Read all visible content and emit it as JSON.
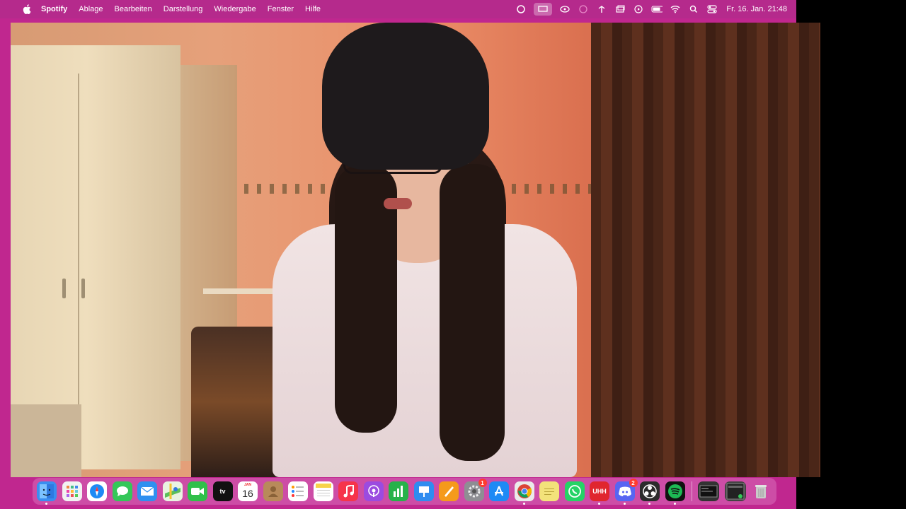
{
  "menubar": {
    "app_name": "Spotify",
    "items": [
      "Ablage",
      "Bearbeiten",
      "Darstellung",
      "Wiedergabe",
      "Fenster",
      "Hilfe"
    ],
    "clock": "Fr. 16. Jan.  21:48",
    "status_icons": [
      "creative-cloud-icon",
      "screen-mirroring-icon",
      "share-icon",
      "record-icon",
      "network-icon",
      "window-icon",
      "play-icon",
      "battery-icon",
      "wifi-icon",
      "search-icon",
      "control-center-icon"
    ]
  },
  "colors": {
    "desktop": "#c0278f",
    "menubar": "#b52a8c"
  },
  "dock": {
    "calendar_month": "JAN",
    "calendar_day": "16",
    "apps": [
      {
        "name": "finder-icon",
        "color": "#3a8ef0"
      },
      {
        "name": "launchpad-icon",
        "color": "#e86a5f"
      },
      {
        "name": "safari-icon",
        "color": "#1e8af5"
      },
      {
        "name": "messages-icon",
        "color": "#34c759"
      },
      {
        "name": "mail-icon",
        "color": "#2f90f0"
      },
      {
        "name": "maps-icon",
        "color": "#5bbf5b"
      },
      {
        "name": "facetime-icon",
        "color": "#30c04a"
      },
      {
        "name": "apple-tv-icon",
        "color": "#111111"
      },
      {
        "name": "calendar-icon",
        "color": "#ffffff"
      },
      {
        "name": "contacts-icon",
        "color": "#b88a5a"
      },
      {
        "name": "reminders-icon",
        "color": "#ffffff"
      },
      {
        "name": "notes-icon",
        "color": "#f7d34a"
      },
      {
        "name": "music-icon",
        "color": "#f6344a"
      },
      {
        "name": "podcasts-icon",
        "color": "#9b4be0"
      },
      {
        "name": "numbers-icon",
        "color": "#27b24a"
      },
      {
        "name": "keynote-icon",
        "color": "#2f8cf0"
      },
      {
        "name": "pages-icon",
        "color": "#f59a1b"
      },
      {
        "name": "system-settings-icon",
        "color": "#8e8e93"
      },
      {
        "name": "app-store-icon",
        "color": "#1e8af5"
      },
      {
        "name": "chrome-icon",
        "color": "#eaeaea"
      },
      {
        "name": "stickies-icon",
        "color": "#f3e27a"
      },
      {
        "name": "whatsapp-icon",
        "color": "#25d366"
      },
      {
        "name": "uhh-icon",
        "color": "#e0262e"
      },
      {
        "name": "discord-icon",
        "color": "#5865f2"
      },
      {
        "name": "obs-icon",
        "color": "#2b2b2b"
      },
      {
        "name": "spotify-icon",
        "color": "#1db954"
      }
    ],
    "badges": {
      "system_settings": "1",
      "discord": "2"
    },
    "other_items": [
      {
        "name": "screenshot-window-icon",
        "color": "#333333"
      },
      {
        "name": "app-window-icon",
        "color": "#444444"
      },
      {
        "name": "trash-icon",
        "color": "#c9c9c9"
      }
    ],
    "uhh_label": "UHH"
  }
}
